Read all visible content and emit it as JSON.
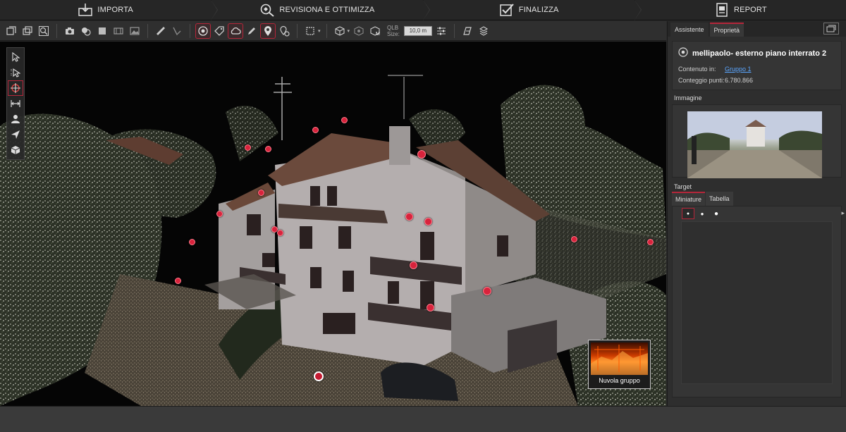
{
  "workflow": {
    "steps": [
      {
        "label": "IMPORTA",
        "icon": "import-icon",
        "active": false
      },
      {
        "label": "REVISIONA E OTTIMIZZA",
        "icon": "review-icon",
        "active": false
      },
      {
        "label": "FINALIZZA",
        "icon": "finalize-icon",
        "active": false
      },
      {
        "label": "REPORT",
        "icon": "report-icon",
        "active": false
      }
    ]
  },
  "toolbar": {
    "qlb_label_line1": "QLB",
    "qlb_label_line2": "Size:",
    "qlb_value": "10,0 m"
  },
  "viewport": {
    "thumbnail_label": "Nuvola gruppo"
  },
  "panel": {
    "tabs": [
      "Assistente",
      "Proprietà"
    ],
    "active_tab": "Proprietà",
    "object_name": "mellipaolo- esterno piano interrato 2",
    "props": [
      {
        "key": "Contenuto in:",
        "value": "Gruppo 1",
        "link": true
      },
      {
        "key": "Conteggio punti:",
        "value": "6.780.866",
        "link": false
      }
    ],
    "image_title": "Immagine",
    "target_title": "Target",
    "target_tabs": [
      "Miniature",
      "Tabella"
    ],
    "active_target_tab": "Miniature"
  },
  "colors": {
    "accent": "#b5263a",
    "marker": "#d8233c",
    "link": "#5aa6ff",
    "background": "#2b2b2b"
  }
}
